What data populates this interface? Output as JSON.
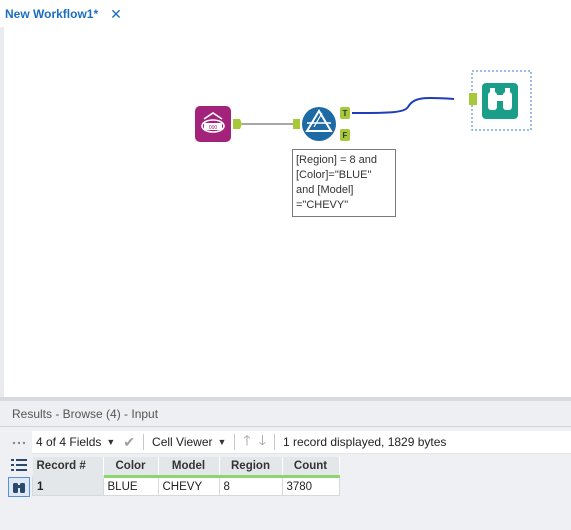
{
  "tab": {
    "title": "New Workflow1*"
  },
  "canvas": {
    "filter_annotation": "[Region] = 8 and\n[Color]=\"BLUE\"\nand [Model]\n=\"CHEVY\"",
    "filter_true_label": "T",
    "filter_false_label": "F"
  },
  "results": {
    "title": "Results - Browse (4) - Input",
    "toolbar": {
      "fields_label": "4 of 4 Fields",
      "viewer_label": "Cell Viewer",
      "status": "1 record displayed, 1829 bytes"
    },
    "columns": [
      "Record #",
      "Color",
      "Model",
      "Region",
      "Count"
    ],
    "rows": [
      [
        "1",
        "BLUE",
        "CHEVY",
        "8",
        "3780"
      ]
    ]
  },
  "colors": {
    "input_tool": "#a3237a",
    "filter_tool": "#1d6aa5",
    "browse_tool": "#1a9e8a",
    "connector_true": "#1f3db8",
    "anchor": "#a6c93a",
    "accent": "#1b6ec2"
  }
}
